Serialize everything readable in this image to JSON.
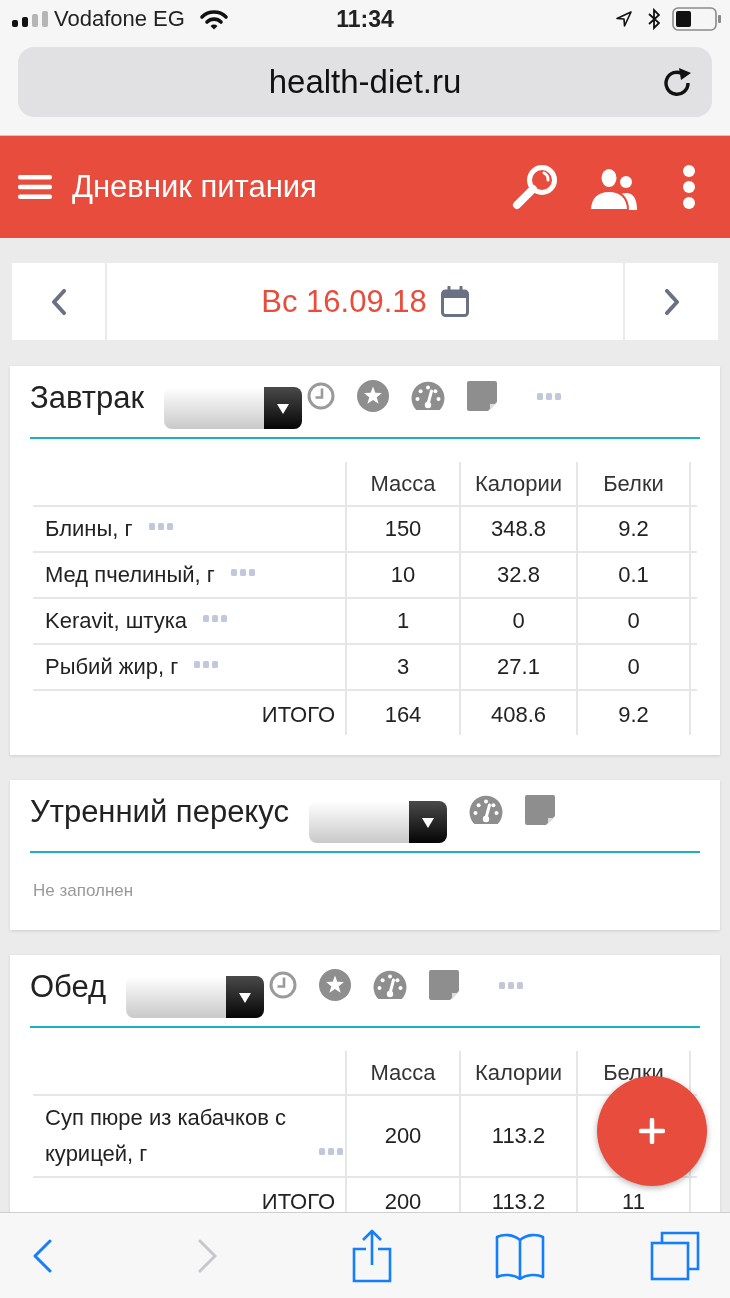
{
  "status_bar": {
    "carrier": "Vodafone EG",
    "time": "11:34"
  },
  "browser": {
    "url": "health-diet.ru"
  },
  "app_bar": {
    "title": "Дневник питания"
  },
  "date_nav": {
    "date": "Вс 16.09.18"
  },
  "meals": [
    {
      "title": "Завтрак",
      "tools": [
        {
          "kind": "clock"
        },
        {
          "kind": "star"
        },
        {
          "kind": "gauge"
        },
        {
          "kind": "note"
        },
        {
          "kind": "more"
        }
      ],
      "table": {
        "columns": [
          "Масса",
          "Калории",
          "Белки"
        ],
        "rows": [
          {
            "name": "Блины, г",
            "cells": [
              "150",
              "348.8",
              "9.2"
            ]
          },
          {
            "name": "Мед пчелиный, г",
            "cells": [
              "10",
              "32.8",
              "0.1"
            ]
          },
          {
            "name": "Keravit, штука",
            "cells": [
              "1",
              "0",
              "0"
            ]
          },
          {
            "name": "Рыбий жир, г",
            "cells": [
              "3",
              "27.1",
              "0"
            ]
          }
        ],
        "total": {
          "label": "ИТОГО",
          "cells": [
            "164",
            "408.6",
            "9.2"
          ]
        }
      }
    },
    {
      "title": "Утренний перекус",
      "tools": [
        {
          "kind": "gauge"
        },
        {
          "kind": "note"
        }
      ],
      "empty_text": "Не заполнен"
    },
    {
      "title": "Обед",
      "tools": [
        {
          "kind": "clock"
        },
        {
          "kind": "star"
        },
        {
          "kind": "gauge"
        },
        {
          "kind": "note"
        },
        {
          "kind": "more"
        }
      ],
      "table": {
        "columns": [
          "Масса",
          "Калории",
          "Белки"
        ],
        "rows": [
          {
            "name": "Суп пюре из кабачков с курицей, г",
            "cells": [
              "200",
              "113.2"
            ]
          }
        ],
        "total": {
          "label": "ИТОГО",
          "cells": [
            "200",
            "113.2",
            "11"
          ]
        }
      }
    }
  ],
  "browser_toolbar": {
    "buttons": [
      {
        "kind": "back",
        "disabled": false
      },
      {
        "kind": "forward",
        "disabled": true
      },
      {
        "kind": "share",
        "disabled": false
      },
      {
        "kind": "bookmarks",
        "disabled": false
      },
      {
        "kind": "tabs",
        "disabled": false
      }
    ]
  }
}
